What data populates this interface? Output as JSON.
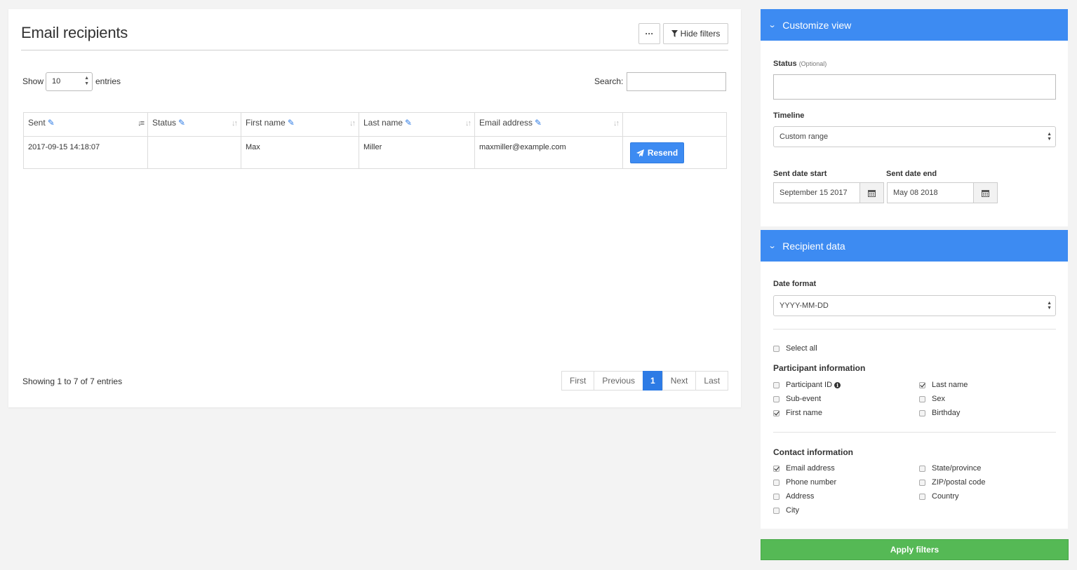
{
  "header": {
    "title": "Email recipients",
    "more_label": "···",
    "hide_filters_label": "Hide filters"
  },
  "table_controls": {
    "show_label": "Show",
    "entries_label": "entries",
    "length_value": "10",
    "search_label": "Search:"
  },
  "table": {
    "columns": [
      "Sent",
      "Status",
      "First name",
      "Last name",
      "Email address"
    ],
    "rows": [
      {
        "sent": "2017-09-15 14:18:07",
        "status": "",
        "first_name": "Max",
        "last_name": "Miller",
        "email": "maxmiller@example.com",
        "action": "Resend"
      }
    ]
  },
  "footer": {
    "showing": "Showing 1 to 7 of 7 entries",
    "pager": {
      "first": "First",
      "previous": "Previous",
      "current": "1",
      "next": "Next",
      "last": "Last"
    }
  },
  "customize_view": {
    "title": "Customize view",
    "status_label": "Status",
    "status_optional": "(Optional)",
    "timeline_label": "Timeline",
    "timeline_value": "Custom range",
    "sent_start_label": "Sent date start",
    "sent_start_value": "September 15 2017",
    "sent_end_label": "Sent date end",
    "sent_end_value": "May 08 2018"
  },
  "recipient_data": {
    "title": "Recipient data",
    "date_format_label": "Date format",
    "date_format_value": "YYYY-MM-DD",
    "select_all": "Select all",
    "participant_title": "Participant information",
    "participant_fields": [
      {
        "label": "Participant ID",
        "checked": false
      },
      {
        "label": "Sub-event",
        "checked": false
      },
      {
        "label": "First name",
        "checked": true
      },
      {
        "label": "Last name",
        "checked": true
      },
      {
        "label": "Sex",
        "checked": false
      },
      {
        "label": "Birthday",
        "checked": false
      }
    ],
    "contact_title": "Contact information",
    "contact_fields": [
      {
        "label": "Email address",
        "checked": true
      },
      {
        "label": "Phone number",
        "checked": false
      },
      {
        "label": "Address",
        "checked": false
      },
      {
        "label": "City",
        "checked": false
      },
      {
        "label": "State/province",
        "checked": false
      },
      {
        "label": "ZIP/postal code",
        "checked": false
      },
      {
        "label": "Country",
        "checked": false
      }
    ]
  },
  "apply_label": "Apply filters",
  "colors": {
    "accent": "#3d8bf2",
    "apply": "#55b955",
    "page_bg": "#f3f3f3"
  }
}
